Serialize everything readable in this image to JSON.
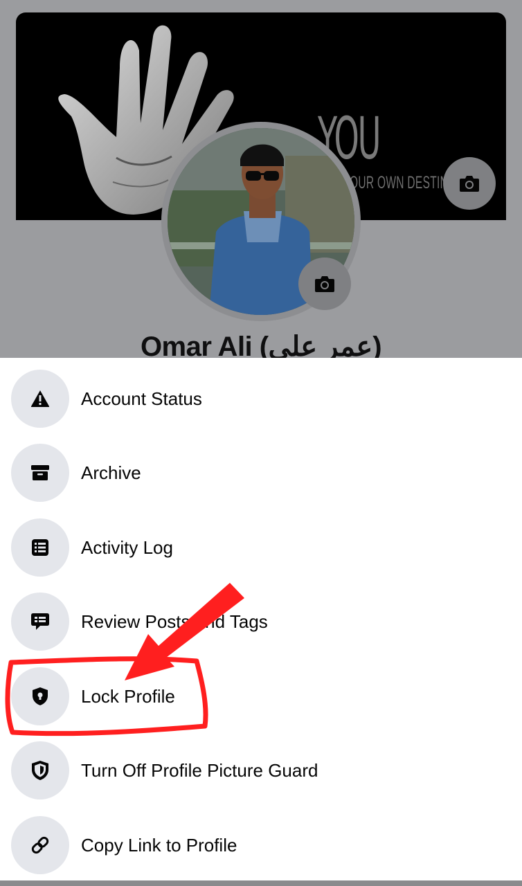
{
  "profile": {
    "name": "Omar Ali (عمر علي)",
    "cover_text": "YOU",
    "cover_subtext": "OUR OWN DESTIN"
  },
  "icons": {
    "cover_camera": "camera-icon",
    "avatar_camera": "camera-icon"
  },
  "menu": {
    "items": [
      {
        "label": "Account Status",
        "icon": "warning-icon"
      },
      {
        "label": "Archive",
        "icon": "archive-box-icon"
      },
      {
        "label": "Activity Log",
        "icon": "list-icon"
      },
      {
        "label": "Review Posts and Tags",
        "icon": "speech-bubble-icon"
      },
      {
        "label": "Lock Profile",
        "icon": "lock-shield-icon"
      },
      {
        "label": "Turn Off Profile Picture Guard",
        "icon": "shield-icon"
      },
      {
        "label": "Copy Link to Profile",
        "icon": "link-icon"
      }
    ]
  },
  "colors": {
    "annotation_red": "#ff1f1f",
    "icon_bg": "#e4e6eb",
    "overlay": "#9b9c9f"
  }
}
